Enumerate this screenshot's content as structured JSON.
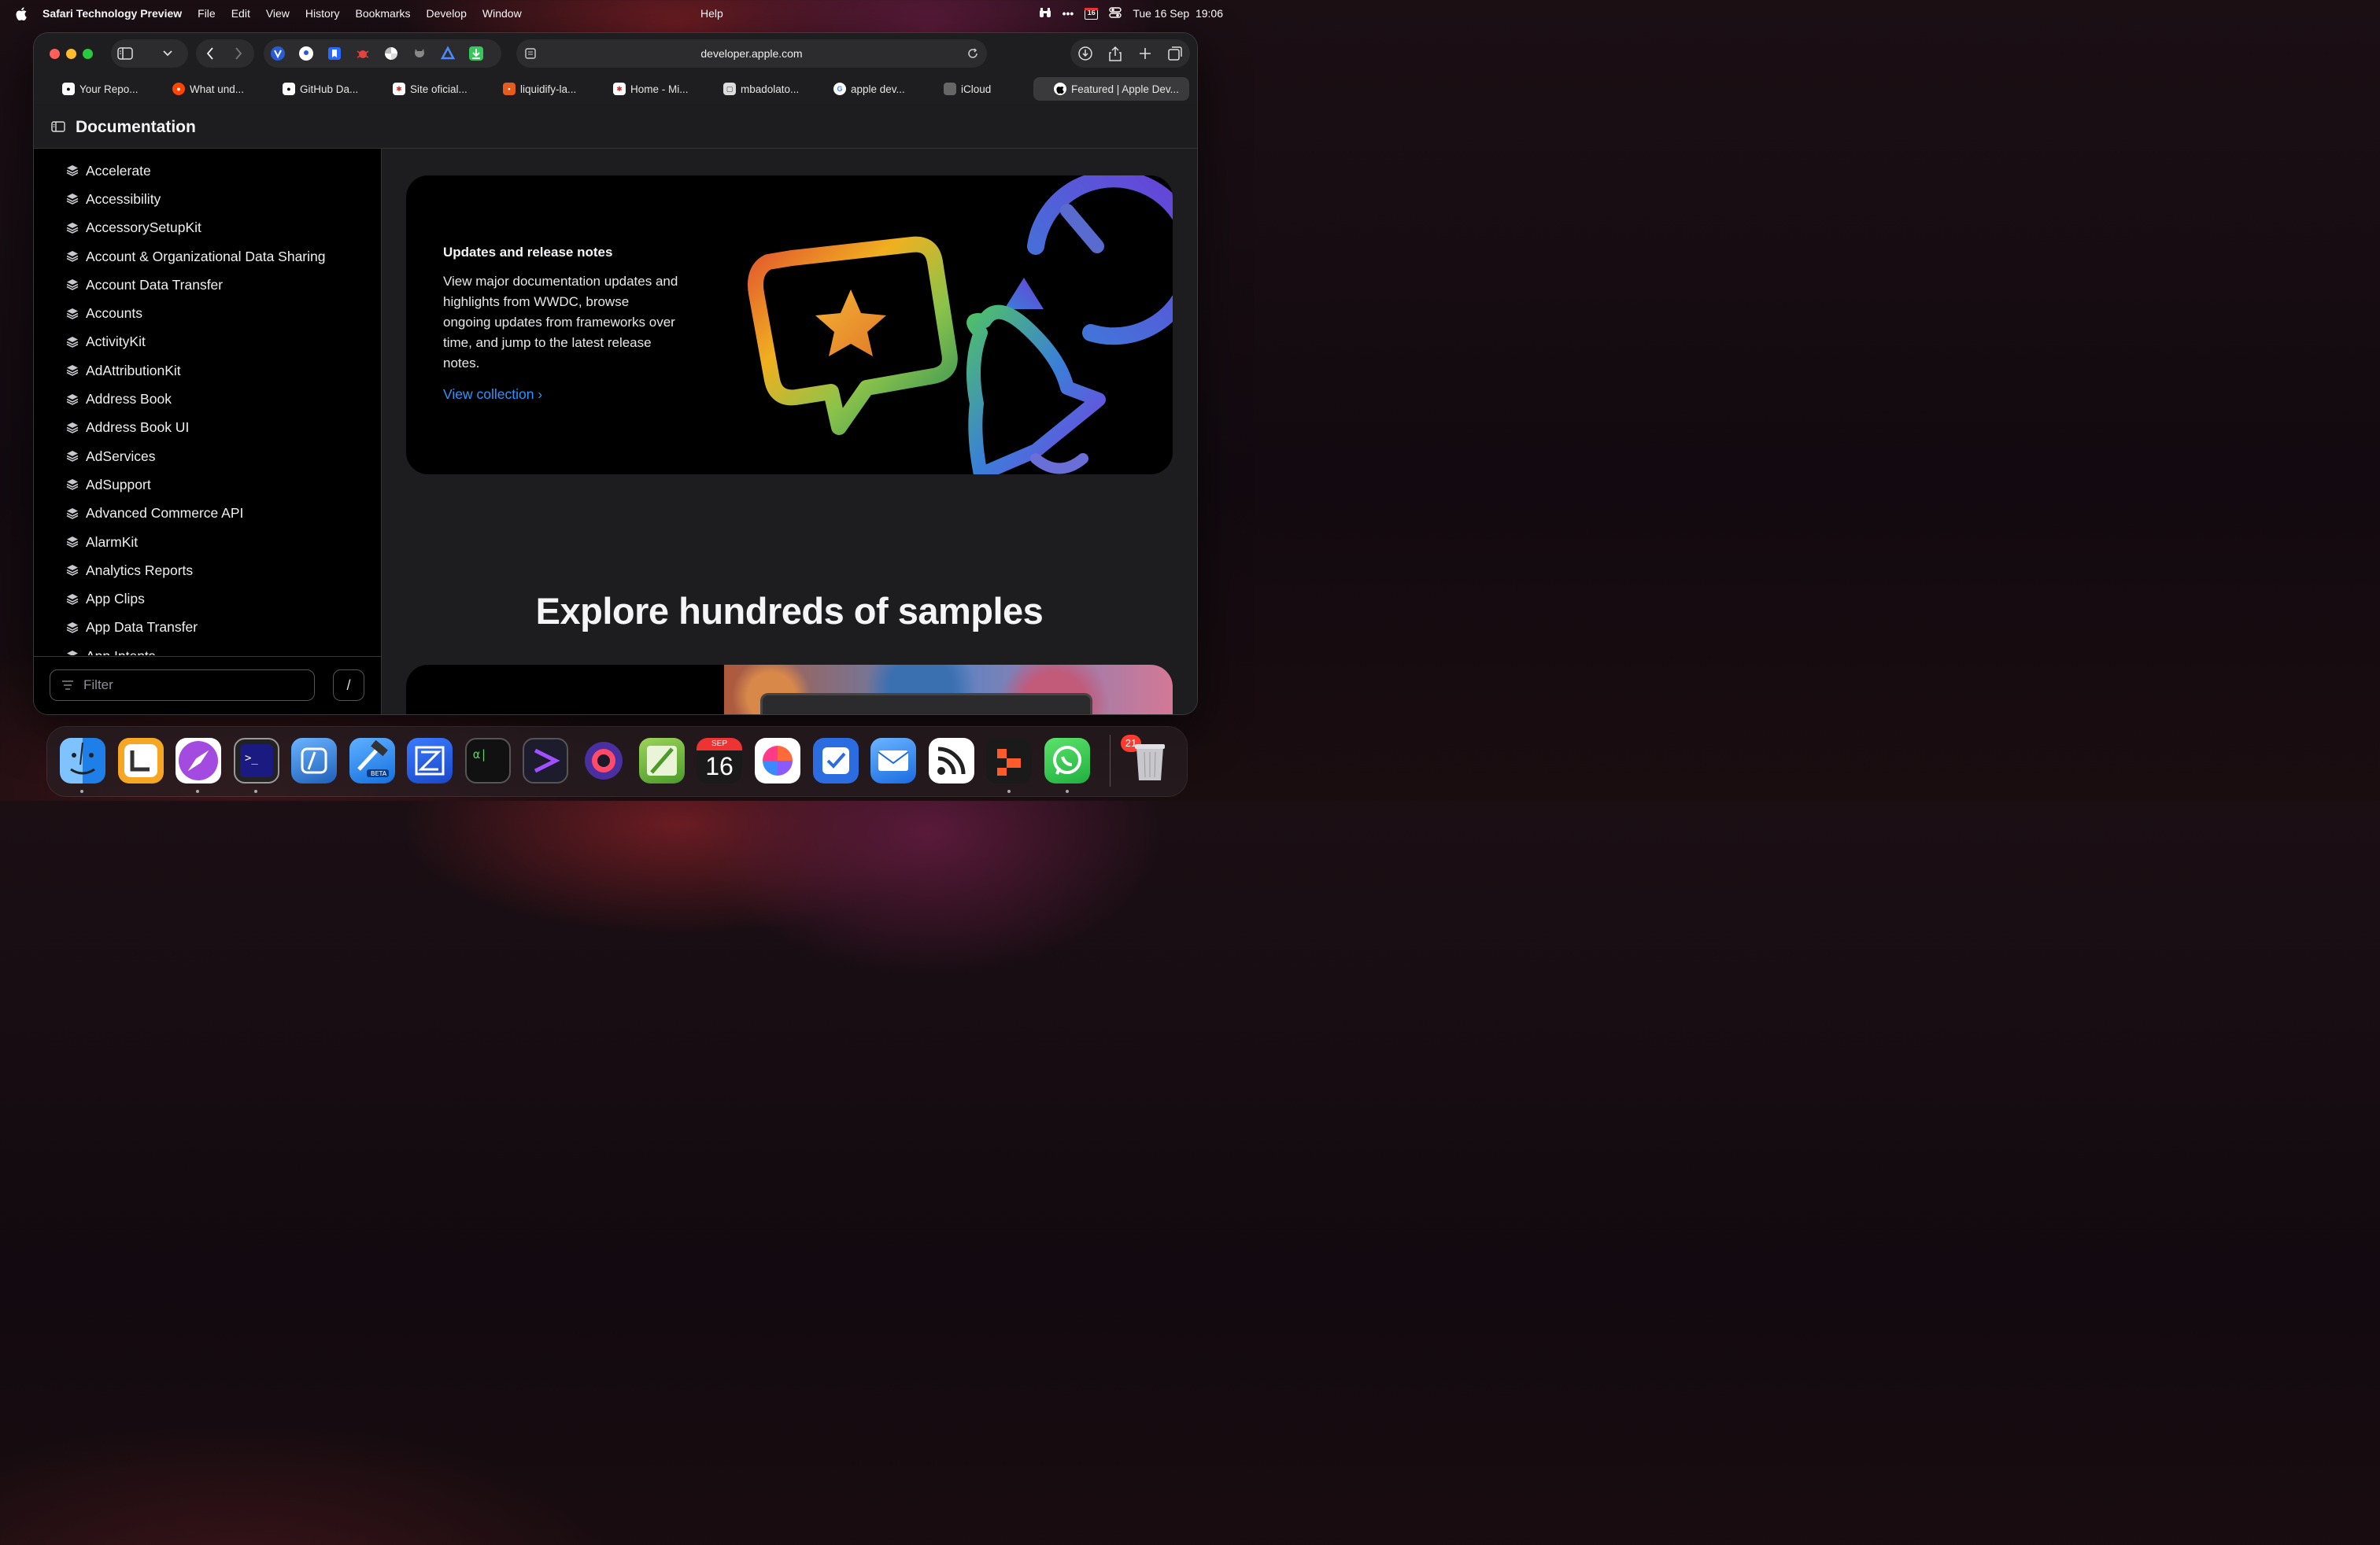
{
  "menubar": {
    "app_name": "Safari Technology Preview",
    "items": [
      "File",
      "Edit",
      "View",
      "History",
      "Bookmarks",
      "Develop",
      "Window"
    ],
    "help": "Help",
    "status": {
      "more": "•••",
      "calendar_day": "16",
      "date_time": "Tue 16 Sep  19:06"
    }
  },
  "address_bar": {
    "url": "developer.apple.com"
  },
  "tabs": [
    {
      "label": "Your Repo...",
      "icon": "github-icon"
    },
    {
      "label": "What und...",
      "icon": "reddit-icon"
    },
    {
      "label": "GitHub Da...",
      "icon": "github-icon"
    },
    {
      "label": "Site oficial...",
      "icon": "site-icon"
    },
    {
      "label": "liquidify-la...",
      "icon": "liquidify-icon"
    },
    {
      "label": "Home - Mi...",
      "icon": "home-icon"
    },
    {
      "label": "mbadolato...",
      "icon": "repo-icon"
    },
    {
      "label": "apple dev...",
      "icon": "google-icon"
    },
    {
      "label": "iCloud",
      "icon": "apple-icon"
    },
    {
      "label": "Featured | Apple Dev...",
      "icon": "apple-icon"
    }
  ],
  "doc": {
    "title": "Documentation"
  },
  "sidebar": {
    "items": [
      "Accelerate",
      "Accessibility",
      "AccessorySetupKit",
      "Account & Organizational Data Sharing",
      "Account Data Transfer",
      "Accounts",
      "ActivityKit",
      "AdAttributionKit",
      "Address Book",
      "Address Book UI",
      "AdServices",
      "AdSupport",
      "Advanced Commerce API",
      "AlarmKit",
      "Analytics Reports",
      "App Clips",
      "App Data Transfer",
      "App Intents"
    ],
    "filter_placeholder": "Filter",
    "shortcut": "/"
  },
  "featured": {
    "title": "Updates and release notes",
    "body": "View major documentation updates and highlights from WWDC, browse ongoing updates from frameworks over time, and jump to the latest release notes.",
    "link": "View collection ›"
  },
  "samples": {
    "heading": "Explore hundreds of samples"
  },
  "dock": {
    "apps": [
      "finder",
      "lasso",
      "safari-tp",
      "ghost-terminal",
      "linear",
      "xcode-beta",
      "zed",
      "alpha-terminal",
      "prompt",
      "arc",
      "pencil",
      "calendar",
      "craft",
      "tasks",
      "mail",
      "rss",
      "layers",
      "whatsapp"
    ],
    "calendar_month": "SEP",
    "calendar_day": "16",
    "whatsapp_badge": "21"
  }
}
